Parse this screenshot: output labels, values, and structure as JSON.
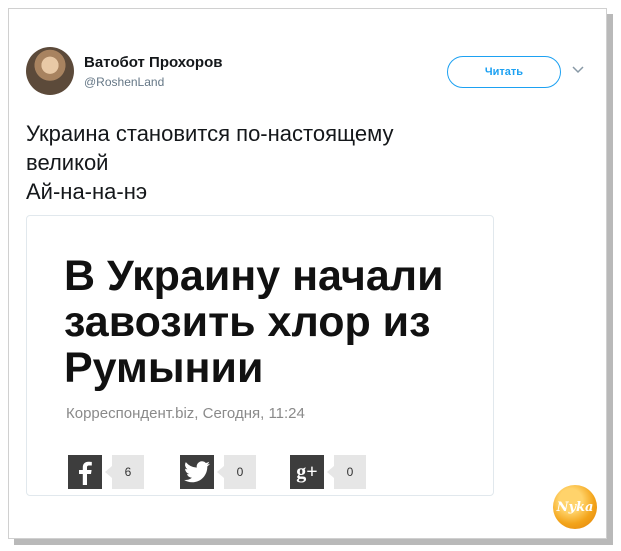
{
  "author": {
    "name": "Ватобот Прохоров",
    "handle": "@RoshenLand"
  },
  "follow_button_label": "Читать",
  "tweet_lines": [
    "Украина становится по-настоящему",
    "великой",
    "Ай-на-на-нэ"
  ],
  "card": {
    "headline_lines": [
      "В Украину начали",
      "завозить хлор из",
      "Румынии"
    ],
    "meta": "Корреспондент.biz, Сегодня, 11:24",
    "share": [
      {
        "icon": "facebook-icon",
        "glyph": "f",
        "count": "6"
      },
      {
        "icon": "twitter-icon",
        "glyph": "t",
        "count": "0"
      },
      {
        "icon": "google-plus-icon",
        "glyph": "g+",
        "count": "0"
      }
    ]
  },
  "watermark": "Nyka",
  "colors": {
    "accent": "#1da1f2",
    "text": "#14171a",
    "muted": "#657786",
    "share_icon_bg": "#3d3d3d",
    "logo": "#f3a41a"
  }
}
